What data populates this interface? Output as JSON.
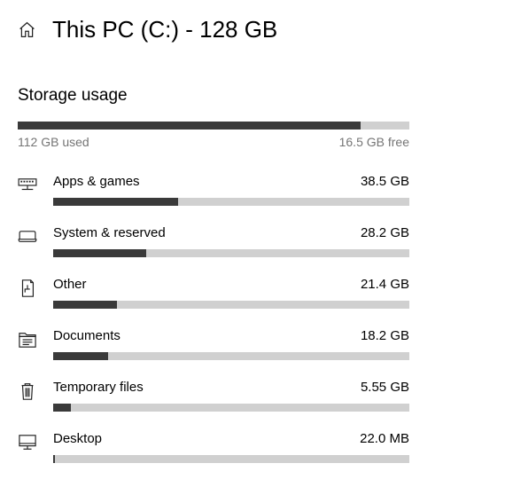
{
  "header": {
    "title": "This PC (C:) - 128 GB"
  },
  "section": {
    "heading": "Storage usage"
  },
  "overall": {
    "used_label": "112 GB used",
    "free_label": "16.5 GB free",
    "used_pct": 87.5
  },
  "categories": [
    {
      "icon": "apps",
      "name": "Apps & games",
      "size": "38.5 GB",
      "pct": 35.0
    },
    {
      "icon": "system",
      "name": "System & reserved",
      "size": "28.2 GB",
      "pct": 26.0
    },
    {
      "icon": "other",
      "name": "Other",
      "size": "21.4 GB",
      "pct": 18.0
    },
    {
      "icon": "documents",
      "name": "Documents",
      "size": "18.2 GB",
      "pct": 15.5
    },
    {
      "icon": "trash",
      "name": "Temporary files",
      "size": "5.55 GB",
      "pct": 5.0
    },
    {
      "icon": "desktop",
      "name": "Desktop",
      "size": "22.0 MB",
      "pct": 0.5
    }
  ]
}
